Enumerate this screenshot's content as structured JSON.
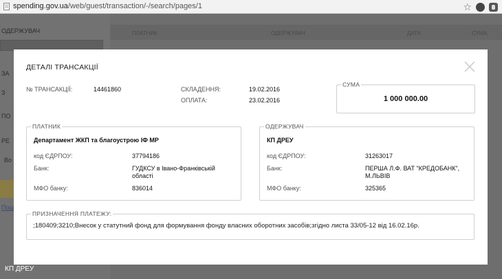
{
  "browser": {
    "url_host": "spending.gov.ua",
    "url_path": "/web/guest/transaction/-/search/pages/1"
  },
  "background": {
    "sidebar_labels": [
      "ОДЕРЖУВАЧ",
      "ЗА",
      "З",
      "ПО",
      "РЕ",
      "Во"
    ],
    "link": "Пош",
    "columns": [
      "ПЛАТНИК",
      "ОДЕРЖУВАЧ",
      "ДАТА",
      "СУМА"
    ]
  },
  "modal": {
    "title": "ДЕТАЛІ ТРАНСАКЦІЇ",
    "transaction_label": "№ ТРАНСАКЦІЇ:",
    "transaction_id": "14461860",
    "composed_label": "СКЛАДЕННЯ:",
    "composed_date": "19.02.2016",
    "paid_label": "ОПЛАТА:",
    "paid_date": "23.02.2016",
    "amount_label": "СУМА",
    "amount": "1 000 000.00",
    "payer": {
      "legend": "ПЛАТНИК",
      "name": "Департамент ЖКП та благоустрою ІФ МР",
      "edrpou_label": "код ЄДРПОУ:",
      "edrpou": "37794186",
      "bank_label": "Банк:",
      "bank_line1": "ГУДКСУ в Івано-Франківській",
      "bank_line2": "області",
      "mfo_label": "МФО банку:",
      "mfo": "836014"
    },
    "recipient": {
      "legend": "ОДЕРЖУВАЧ",
      "name": "КП ДРЕУ",
      "edrpou_label": "код ЄДРПОУ:",
      "edrpou": "31263017",
      "bank_label": "Банк:",
      "bank_line1": "ПЕРША Л.Ф. ВАТ \"КРЕДОБАНК\",",
      "bank_line2": "М.ЛЬВІВ",
      "mfo_label": "МФО банку:",
      "mfo": "325365"
    },
    "purpose_label": "ПРИЗНАЧЕННЯ ПЛАТЕЖУ:",
    "purpose_text": ";180409;3210;Внесок у статутний фонд для формування фонду власних оборотних засобів;згідно листа 33/05-12 від 16.02.16р."
  },
  "status_text": "КП ДРЕУ",
  "colors": {
    "overlay": "#6e6e6e",
    "modal_bg": "#ffffff",
    "border": "#d0d0d0"
  }
}
